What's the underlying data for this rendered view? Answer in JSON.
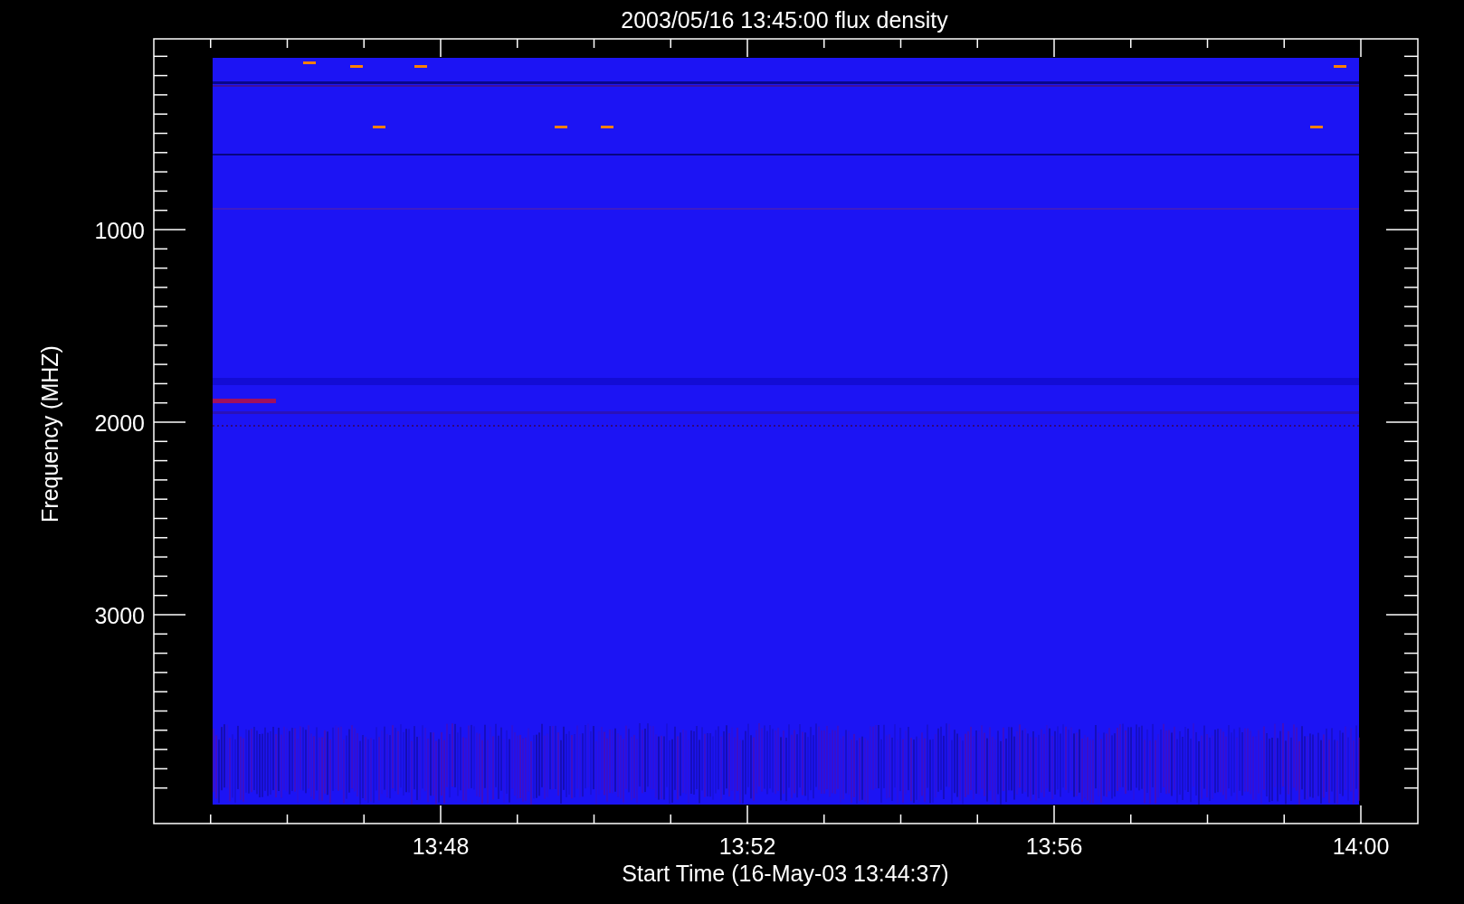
{
  "plot": {
    "title": "2003/05/16 13:45:00 flux density",
    "y_axis": {
      "label": "Frequency (MHZ)",
      "tick_labels": [
        "1000",
        "2000",
        "3000"
      ]
    },
    "x_axis": {
      "label": "Start Time (16-May-03 13:44:37)",
      "tick_labels": [
        "13:48",
        "13:52",
        "13:56",
        "14:00"
      ]
    }
  }
}
